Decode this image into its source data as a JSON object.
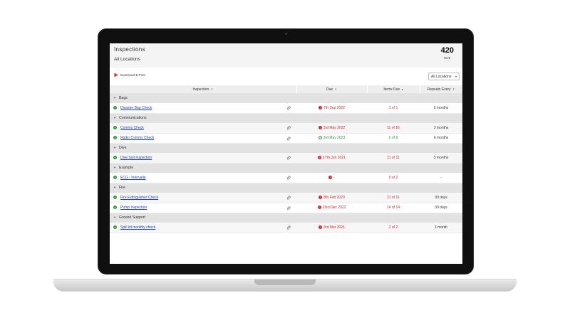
{
  "header": {
    "title": "Inspections",
    "subtitle": "All Locations",
    "due_count": "420",
    "due_label": "DUE"
  },
  "toolbar": {
    "download_label": "Download & Print",
    "location_value": "All Locations"
  },
  "columns": {
    "inspection": "Inspection",
    "due": "Due",
    "items_due": "Items Due",
    "repeats": "Repeats Every"
  },
  "groups": [
    {
      "name": "Bags",
      "rows": [
        {
          "name": "Disaster Bag Check",
          "due": "7th Sep 2022",
          "items": "1 of 1",
          "repeats": "6 months",
          "status": "overdue"
        }
      ]
    },
    {
      "name": "Communications",
      "rows": [
        {
          "name": "Comms Check",
          "due": "3rd May 2022",
          "items": "11 of 16",
          "repeats": "3 months",
          "status": "overdue"
        },
        {
          "name": "Radio Comms Check",
          "due": "3rd May 2023",
          "items": "0 of 8",
          "repeats": "6 months",
          "status": "ok"
        }
      ]
    },
    {
      "name": "Dive",
      "rows": [
        {
          "name": "Dive Suit Inspection",
          "due": "17th Jun 2021",
          "items": "11 of 11",
          "repeats": "3 months",
          "status": "overdue"
        }
      ]
    },
    {
      "name": "Example",
      "rows": [
        {
          "name": "ECG - Intervalle",
          "due": "-",
          "items": "0 of 2",
          "repeats": "-",
          "status": "overdue"
        }
      ]
    },
    {
      "name": "Fire",
      "rows": [
        {
          "name": "Fire Extinguisher Check",
          "due": "8th Feb 2020",
          "items": "11 of 11",
          "repeats": "30 days",
          "status": "overdue"
        },
        {
          "name": "Pump Inspection",
          "due": "23rd Dec 2022",
          "items": "14 of 14",
          "repeats": "30 days",
          "status": "overdue"
        }
      ]
    },
    {
      "name": "Ground Support",
      "rows": [
        {
          "name": "Spill kit monthly check",
          "due": "3rd Mar 2021",
          "items": "2 of 2",
          "repeats": "1 month",
          "status": "overdue"
        }
      ]
    }
  ],
  "colors": {
    "overdue": "#d8252d",
    "ok": "#2e9b3c",
    "link": "#1a3fcf"
  },
  "icons": {
    "download": "pdf-icon",
    "attachment": "paperclip-icon",
    "add": "plus-circle-icon",
    "overdue": "exclamation-circle-icon",
    "ok": "check-circle-icon"
  }
}
